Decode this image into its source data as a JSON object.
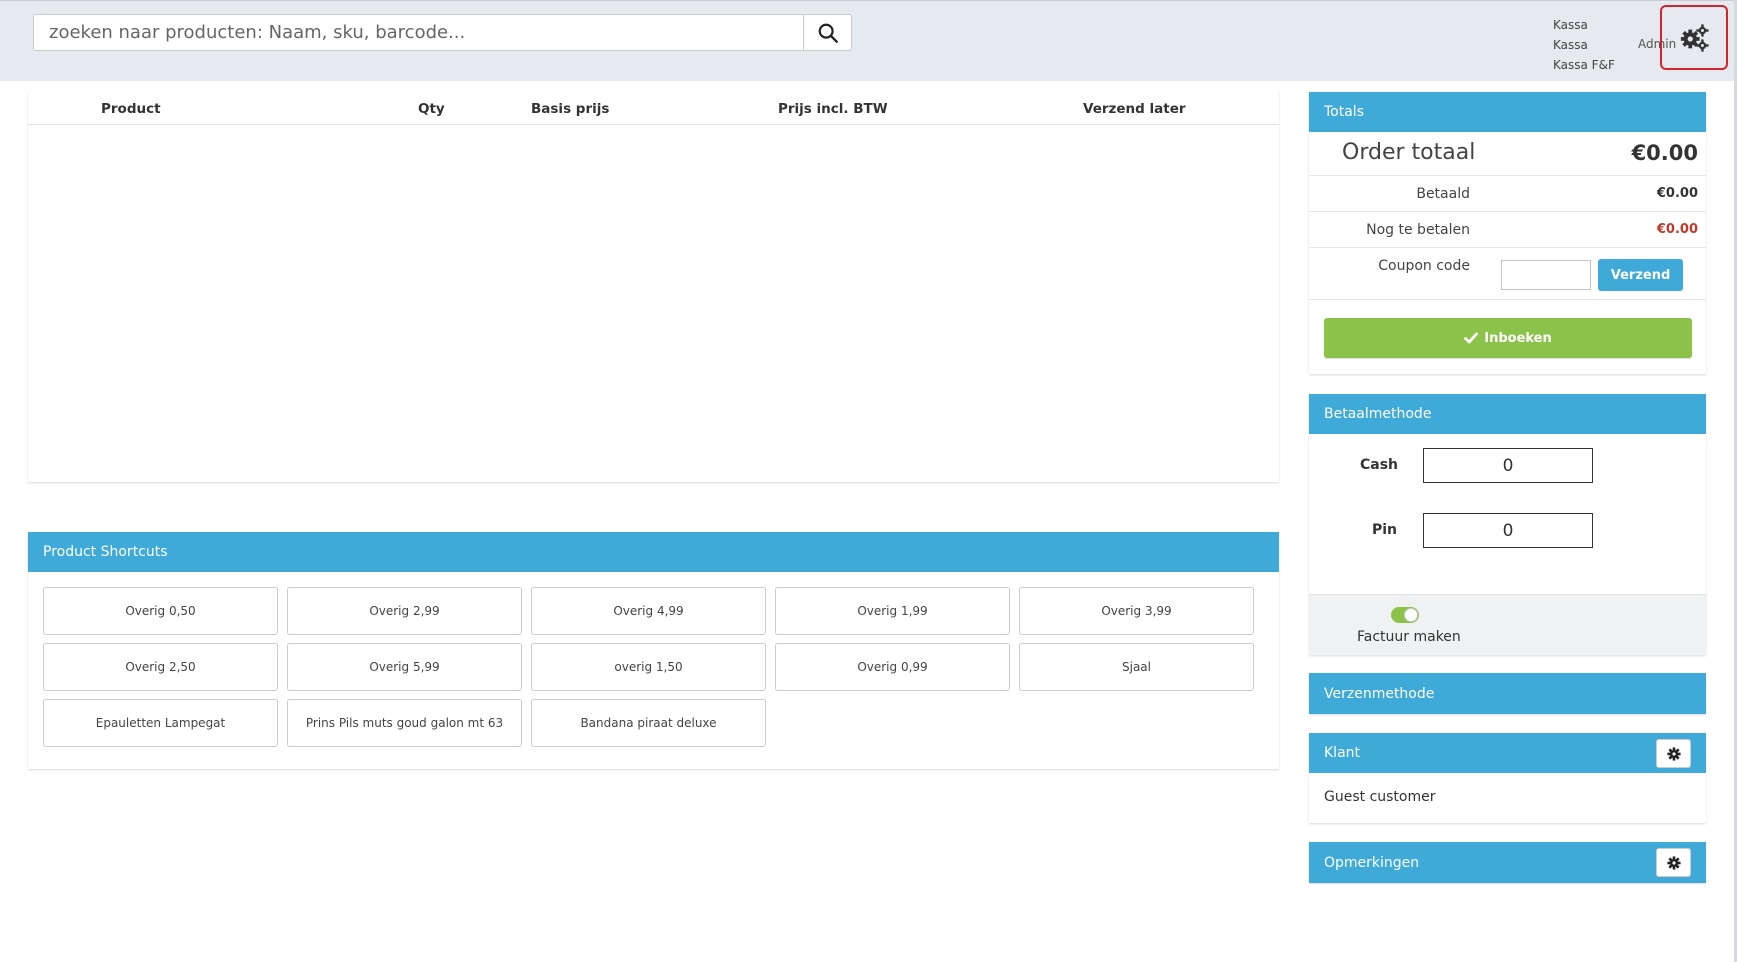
{
  "search": {
    "placeholder": "zoeken naar producten: Naam, sku, barcode...",
    "icon": "search-icon"
  },
  "header": {
    "kassa_items": [
      "Kassa",
      "Kassa",
      "Kassa F&F"
    ],
    "user": "Admin",
    "settings_icon": "gears-icon"
  },
  "cart": {
    "columns": [
      "Product",
      "Qty",
      "Basis prijs",
      "Prijs incl. BTW",
      "Verzend later"
    ],
    "rows": []
  },
  "shortcuts": {
    "title": "Product Shortcuts",
    "items": [
      "Overig 0,50",
      "Overig 2,99",
      "Overig 4,99",
      "Overig 1,99",
      "Overig 3,99",
      "Overig 2,50",
      "Overig 5,99",
      "overig 1,50",
      "Overig 0,99",
      "Sjaal",
      "Epauletten Lampegat",
      "Prins Pils muts goud galon mt 63",
      "Bandana piraat deluxe"
    ]
  },
  "totals": {
    "title": "Totals",
    "order_total_label": "Order totaal",
    "order_total_value": "€0.00",
    "paid_label": "Betaald",
    "paid_value": "€0.00",
    "due_label": "Nog te betalen",
    "due_value": "€0.00",
    "coupon_label": "Coupon code",
    "coupon_value": "",
    "send_button": "Verzend",
    "book_button": "Inboeken"
  },
  "payment": {
    "title": "Betaalmethode",
    "cash_label": "Cash",
    "cash_value": "0",
    "pin_label": "Pin",
    "pin_value": "0",
    "invoice_label": "Factuur maken",
    "invoice_enabled": true
  },
  "shipping": {
    "title": "Verzenmethode"
  },
  "customer": {
    "title": "Klant",
    "name": "Guest customer"
  },
  "remarks": {
    "title": "Opmerkingen"
  },
  "colors": {
    "accent": "#3faad8",
    "success": "#8bc34a",
    "due": "#c0392b",
    "highlight": "#d0262f"
  }
}
